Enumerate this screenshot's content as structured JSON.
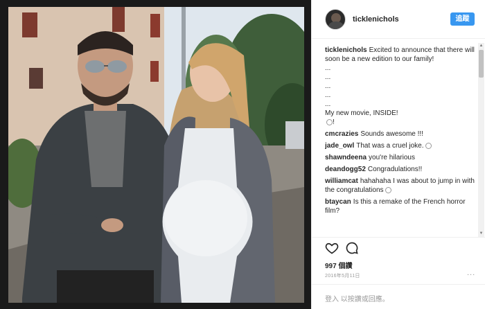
{
  "post": {
    "username": "ticklenichols",
    "follow_label": "追蹤",
    "caption_username": "ticklenichols",
    "caption_lines": [
      "Excited to announce that there will soon be a new edition to our family!",
      "...",
      "...",
      "...",
      "...",
      "...",
      "My new movie, INSIDE!",
      "!"
    ],
    "comments": [
      {
        "user": "cmcrazies",
        "text": "Sounds awesome !!!"
      },
      {
        "user": "jade_owl",
        "text": "That was a cruel joke."
      },
      {
        "user": "shawndeena",
        "text": "you're hilarious"
      },
      {
        "user": "deandogg52",
        "text": "Congradulations!!"
      },
      {
        "user": "williamcat",
        "text": "hahahaha I was about to jump in with the congratulations"
      },
      {
        "user": "btaycan",
        "text": "Is this a remake of the French horror film?"
      }
    ],
    "likes_label": "997 個讚",
    "date": "2016年5月11日",
    "more_label": "...",
    "login_hint": "登入 以按讚或回應。"
  },
  "icons": {
    "like": "heart-outline-icon",
    "comment": "comment-bubble-icon",
    "more": "ellipsis-icon"
  },
  "colors": {
    "accent": "#3897f0",
    "text": "#262626",
    "muted": "#999999",
    "border": "#efefef"
  }
}
